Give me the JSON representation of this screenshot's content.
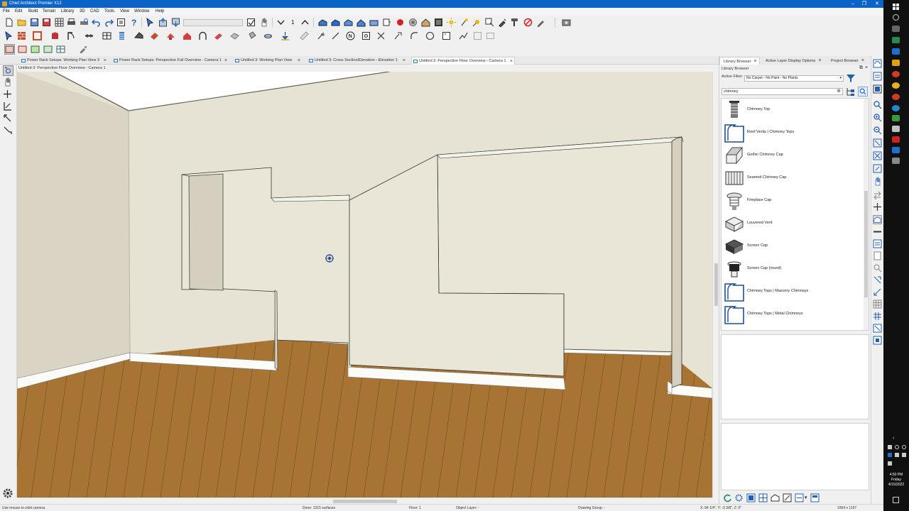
{
  "window": {
    "title": "Chief Architect Premier X12",
    "minimize": "–",
    "restore": "❐",
    "close": "✕"
  },
  "menu": [
    "File",
    "Edit",
    "Build",
    "Terrain",
    "Library",
    "3D",
    "CAD",
    "Tools",
    "View",
    "Window",
    "Help"
  ],
  "toolbar": {
    "number_field": "1"
  },
  "tabs": [
    {
      "label": "Power Rack Setups:  Working Plan View 3",
      "active": false
    },
    {
      "label": "Power Rack Setups:  Perspective Full Overview - Camera 1",
      "active": false
    },
    {
      "label": "Untitled 3:  Working Plan View",
      "active": false
    },
    {
      "label": "Untitled 3:  Cross Section/Elevation - Elevation 1",
      "active": false
    },
    {
      "label": "Untitled 3:  Perspective Floor Overview - Camera 1",
      "active": true
    }
  ],
  "tab_close": "×",
  "viewport": {
    "title": "Untitled 3:  Perspective Floor Overview - Camera 1"
  },
  "library": {
    "tabs": [
      "Library Browser",
      "Active Layer Display Options",
      "Project Browser"
    ],
    "subheader": "Library Browser",
    "filter_label": "Active Filter:",
    "filter_value": "No Carpet - No Paint - No Plants",
    "search_value": "chimney",
    "items": [
      {
        "label": "Chimney Top",
        "icon": "chimney-top-icon"
      },
      {
        "label": "Roof Vents | Chimney Tops",
        "icon": "folder-icon"
      },
      {
        "label": "Gothic Chimney Cap",
        "icon": "gothic-cap-icon"
      },
      {
        "label": "Seamed Chimney Cap",
        "icon": "seamed-cap-icon"
      },
      {
        "label": "Fireplace Cap",
        "icon": "fireplace-cap-icon"
      },
      {
        "label": "Louvered Vent",
        "icon": "louvered-vent-icon"
      },
      {
        "label": "Screen Cap",
        "icon": "screen-cap-icon"
      },
      {
        "label": "Screen Cap (round)",
        "icon": "round-screen-cap-icon"
      },
      {
        "label": "Chimney Tops | Masonry Chimneys",
        "icon": "folder-icon"
      },
      {
        "label": "Chimney Tops | Metal Chimneys",
        "icon": "folder-icon"
      }
    ]
  },
  "status": {
    "hint": "Use mouse to orbit camera.",
    "done": "Done:  1315 surfaces",
    "floor": "Floor: 1",
    "object_layer": "Object Layer: -",
    "drawing_group": "Drawing Group: -",
    "coords": "X: 84 1/4\",  Y: -3 3/8\",  Z: 0\"",
    "size": "1954 x 1197"
  },
  "clock": {
    "time": "4:50 PM",
    "day": "Friday",
    "date": "4/15/2022"
  },
  "colors": {
    "titlebar": "#0a64c8",
    "floor": "#a87434",
    "wall": "#e6e2d3"
  }
}
